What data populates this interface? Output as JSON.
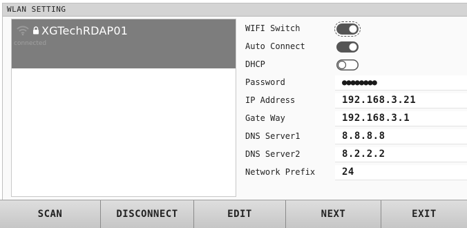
{
  "window": {
    "title": "WLAN SETTING"
  },
  "networks": [
    {
      "ssid": "XGTechRDAP01",
      "status": "connected",
      "icon": "wifi-icon",
      "secured_icon": "lock-icon"
    }
  ],
  "settings": {
    "wifi_switch": {
      "label": "WIFI Switch",
      "on": true
    },
    "auto_connect": {
      "label": "Auto Connect",
      "on": true
    },
    "dhcp": {
      "label": "DHCP",
      "on": false
    },
    "password": {
      "label": "Password",
      "value": "●●●●●●●●"
    },
    "ip_address": {
      "label": "IP Address",
      "value": "192.168.3.21"
    },
    "gateway": {
      "label": "Gate Way",
      "value": "192.168.3.1"
    },
    "dns1": {
      "label": "DNS Server1",
      "value": "8.8.8.8"
    },
    "dns2": {
      "label": "DNS Server2",
      "value": "8.2.2.2"
    },
    "prefix": {
      "label": "Network Prefix",
      "value": "24"
    }
  },
  "buttons": {
    "scan": "SCAN",
    "disconnect": "DISCONNECT",
    "edit": "EDIT",
    "next": "NEXT",
    "exit": "EXIT"
  },
  "colors": {
    "selected_row": "#7d7d7d",
    "toggle_on": "#555555",
    "toggle_off": "#ffffff"
  }
}
